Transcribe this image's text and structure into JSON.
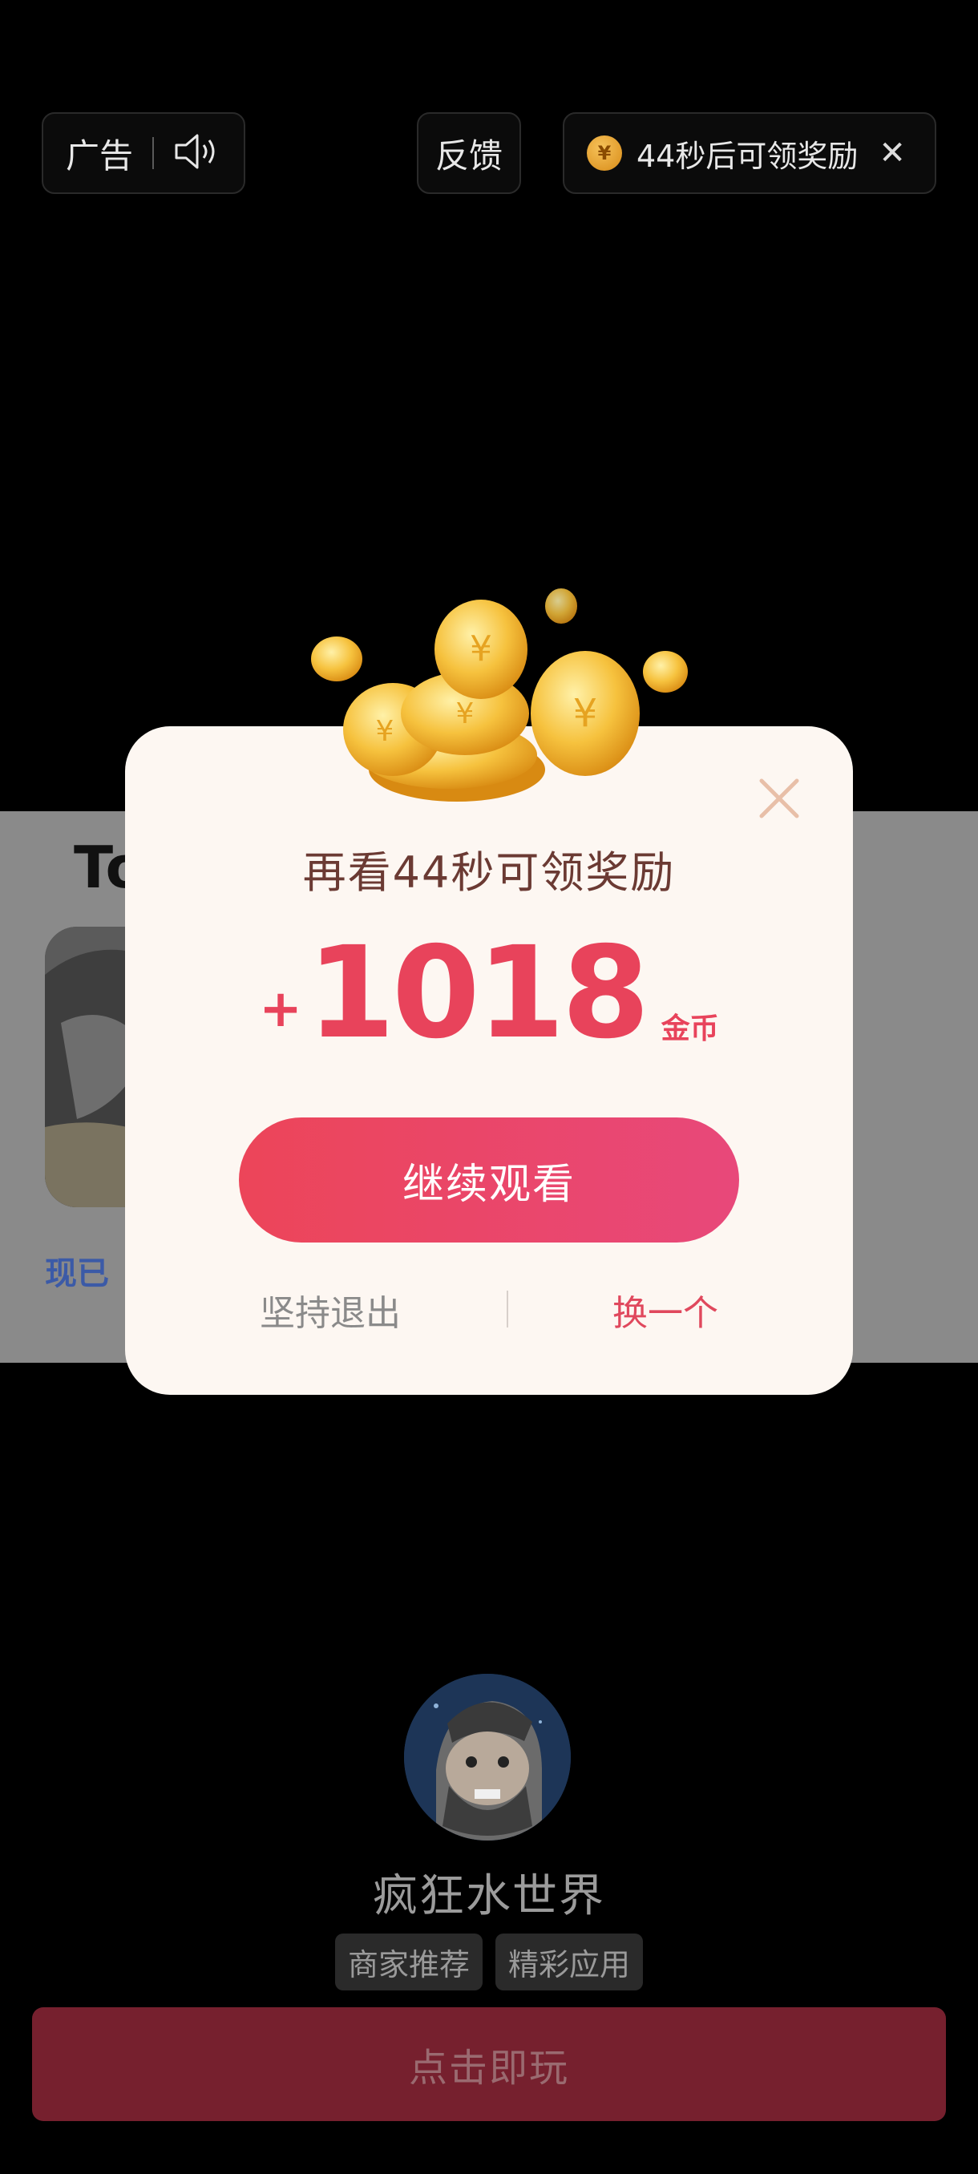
{
  "topbar": {
    "ad_label": "广告",
    "feedback_label": "反馈",
    "coin_symbol": "¥",
    "reward_countdown": "44秒后可领奖励"
  },
  "background_ad": {
    "title_fragment": "To",
    "link_fragment": "现已"
  },
  "popup": {
    "title": "再看44秒可领奖励",
    "plus": "+",
    "amount": "1018",
    "unit": "金币",
    "continue_label": "继续观看",
    "exit_label": "坚持退出",
    "switch_label": "换一个"
  },
  "app": {
    "name": "疯狂水世界",
    "tags": [
      "商家推荐",
      "精彩应用"
    ],
    "play_label": "点击即玩"
  },
  "colors": {
    "accent": "#e8435b",
    "play_button": "#76202e"
  }
}
